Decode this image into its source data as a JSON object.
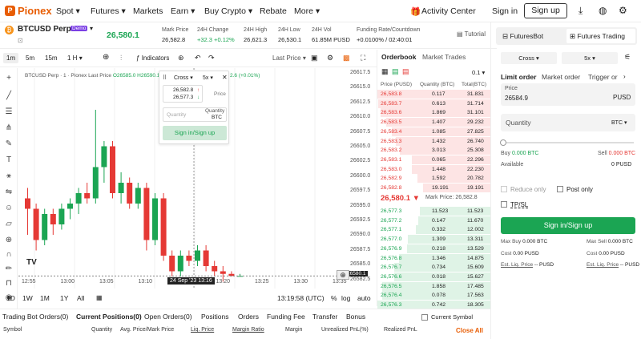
{
  "nav": {
    "logo": "Pionex",
    "logo_mark": "P",
    "items": [
      "Spot",
      "Futures",
      "Markets",
      "Earn",
      "Buy Crypto",
      "Rebate",
      "More"
    ],
    "activity": "Activity Center",
    "signin": "Sign in",
    "signup": "Sign up"
  },
  "ticker": {
    "symbol": "BTCUSD Perp",
    "badge": "Demo",
    "price": "26,580.1",
    "tutorial": "Tutorial",
    "stats": [
      {
        "label": "Mark Price",
        "value": "26,582.8",
        "color": "#222"
      },
      {
        "label": "24H Change",
        "value": "+32.3 +0.12%",
        "color": "#1ba553"
      },
      {
        "label": "24H High",
        "value": "26,621.3",
        "color": "#222"
      },
      {
        "label": "24H Low",
        "value": "26,530.1",
        "color": "#222"
      },
      {
        "label": "24H Vol",
        "value": "61.85M PUSD",
        "color": "#222"
      },
      {
        "label": "Funding Rate/Countdown",
        "value": "+0.0100% / 02:40:01",
        "color": "#222"
      }
    ]
  },
  "toolbar": {
    "intervals": [
      "1m",
      "5m",
      "15m",
      "1 H"
    ],
    "indicators": "Indicators",
    "lastprice": "Last Price"
  },
  "chart": {
    "legend": "BTCUSD Perp · 1 · Pionex Last Price",
    "legend_vals": "O26585.0 H26590.1",
    "change": "2.6 (+0.01%)",
    "price_axis": [
      "26617.5",
      "26615.0",
      "26612.5",
      "26610.0",
      "26607.5",
      "26605.0",
      "26602.5",
      "26600.0",
      "26597.5",
      "26595.0",
      "26592.5",
      "26590.0",
      "26587.5",
      "26585.0",
      "26582.5"
    ],
    "current_price_tag": "26580.1",
    "time_axis": [
      "12:55",
      "13:00",
      "13:05",
      "13:10",
      "13:15",
      "13:20",
      "13:25",
      "13:30",
      "13:35"
    ],
    "crosshair_time": "24 Sep '23  13:16",
    "utc": "13:19:58 (UTC)",
    "ranges": [
      "1D",
      "1W",
      "1M",
      "1Y",
      "All"
    ],
    "scale_opts": [
      "%",
      "log",
      "auto"
    ],
    "wm": "TV"
  },
  "chart_data": {
    "type": "candlestick",
    "x": [
      "12:54",
      "12:55",
      "12:56",
      "12:57",
      "12:58",
      "12:59",
      "13:00",
      "13:01",
      "13:02",
      "13:03",
      "13:04",
      "13:05",
      "13:06",
      "13:07",
      "13:08",
      "13:09",
      "13:10",
      "13:11",
      "13:12",
      "13:13",
      "13:14",
      "13:15",
      "13:16",
      "13:17",
      "13:18",
      "13:19"
    ],
    "candles": [
      [
        26595,
        26597,
        26588,
        26593
      ],
      [
        26593,
        26594,
        26585,
        26587
      ],
      [
        26587,
        26593,
        26586,
        26592
      ],
      [
        26592,
        26593,
        26588,
        26590
      ],
      [
        26590,
        26594,
        26589,
        26593
      ],
      [
        26593,
        26595,
        26591,
        26594
      ],
      [
        26594,
        26597,
        26592,
        26596
      ],
      [
        26596,
        26598,
        26594,
        26595
      ],
      [
        26595,
        26612,
        26594,
        26601
      ],
      [
        26601,
        26606,
        26598,
        26605
      ],
      [
        26605,
        26606,
        26595,
        26596
      ],
      [
        26596,
        26600,
        26594,
        26598
      ],
      [
        26598,
        26599,
        26593,
        26594
      ],
      [
        26594,
        26598,
        26593,
        26597
      ],
      [
        26597,
        26598,
        26585,
        26587
      ],
      [
        26587,
        26596,
        26586,
        26595
      ],
      [
        26595,
        26596,
        26583,
        26584
      ],
      [
        26584,
        26585,
        26580,
        26581
      ],
      [
        26581,
        26585,
        26580,
        26584
      ],
      [
        26584,
        26585,
        26582,
        26583
      ],
      [
        26583,
        26586,
        26582,
        26585
      ],
      [
        26585,
        26586,
        26581,
        26582
      ],
      [
        26582,
        26583,
        26580,
        26581
      ],
      [
        26581,
        26582,
        26579,
        26580.5
      ],
      [
        26580.5,
        26581,
        26580,
        26580.1
      ],
      [
        26580.1,
        26580.5,
        26580,
        26580.1
      ]
    ],
    "ylim": [
      26580,
      26620
    ]
  },
  "popup": {
    "cross": "Cross",
    "lev": "5x",
    "price1": "26,582.8",
    "price2": "26,577.3",
    "price_lbl": "Price",
    "qty_ph": "Quantity",
    "qty_lbl": "Quantity",
    "unit": "BTC",
    "btn": "Sign in/Sign up"
  },
  "book": {
    "tabs": [
      "Orderbook",
      "Market Trades"
    ],
    "step": "0.1",
    "headers": [
      "Price (PUSD)",
      "Quantity (BTC)",
      "Total(BTC)"
    ],
    "asks": [
      [
        "26,583.8",
        "0.117",
        "31.831"
      ],
      [
        "26,583.7",
        "0.613",
        "31.714"
      ],
      [
        "26,583.6",
        "1.869",
        "31.101"
      ],
      [
        "26,583.5",
        "1.407",
        "29.232"
      ],
      [
        "26,583.4",
        "1.085",
        "27.825"
      ],
      [
        "26,583.3",
        "1.432",
        "26.740"
      ],
      [
        "26,583.2",
        "3.013",
        "25.308"
      ],
      [
        "26,583.1",
        "0.065",
        "22.296"
      ],
      [
        "26,583.0",
        "1.448",
        "22.230"
      ],
      [
        "26,582.9",
        "1.592",
        "20.782"
      ],
      [
        "26,582.8",
        "19.191",
        "19.191"
      ]
    ],
    "ask_depth": [
      1.0,
      0.99,
      0.97,
      0.92,
      0.87,
      0.84,
      0.8,
      0.7,
      0.7,
      0.65,
      0.6
    ],
    "last": "26,580.1 ▼",
    "mark": "Mark Price: 26,582.8",
    "bids": [
      [
        "26,577.3",
        "11.523",
        "11.523"
      ],
      [
        "26,577.2",
        "0.147",
        "11.670"
      ],
      [
        "26,577.1",
        "0.332",
        "12.002"
      ],
      [
        "26,577.0",
        "1.309",
        "13.311"
      ],
      [
        "26,576.9",
        "0.218",
        "13.529"
      ],
      [
        "26,576.8",
        "1.346",
        "14.875"
      ],
      [
        "26,576.7",
        "0.734",
        "15.609"
      ],
      [
        "26,576.6",
        "0.018",
        "15.627"
      ],
      [
        "26,576.5",
        "1.858",
        "17.485"
      ],
      [
        "26,576.4",
        "0.078",
        "17.563"
      ],
      [
        "26,576.3",
        "0.742",
        "18.305"
      ]
    ],
    "bid_depth": [
      0.63,
      0.64,
      0.66,
      0.73,
      0.74,
      0.81,
      0.85,
      0.85,
      0.96,
      0.96,
      1.0
    ]
  },
  "panel": {
    "tabs": [
      "FuturesBot",
      "Futures Trading"
    ],
    "margin": "Cross",
    "lev": "5x",
    "types": [
      "Limit order",
      "Market order",
      "Trigger or"
    ],
    "price_lbl": "Price",
    "price_val": "26584.9",
    "price_unit": "PUSD",
    "qty_lbl": "Quantity",
    "qty_unit": "BTC",
    "buy": "Buy",
    "buy_val": "0.000 BTC",
    "sell": "Sell",
    "sell_val": "0.000 BTC",
    "available": "Available",
    "avail_val": "0 PUSD",
    "reduce": "Reduce only",
    "post": "Post only",
    "tpsl": "TP/SL",
    "btn": "Sign in/Sign up",
    "maxbuy_l": "Max Buy",
    "maxbuy": "0.000 BTC",
    "maxsell_l": "Max Sell",
    "maxsell": "0.000 BTC",
    "cost_l": "Cost",
    "cost_buy": "0.00 PUSD",
    "cost_sell": "0.00 PUSD",
    "liq_l": "Est. Liq. Price",
    "liq": "-- PUSD"
  },
  "bottom": {
    "tabs": [
      "Trading Bot Orders(0)",
      "Current Positions(0)",
      "Open Orders(0)",
      "Positions",
      "Orders",
      "Funding Fee",
      "Transfer",
      "Bonus"
    ],
    "current_symbol": "Current Symbol",
    "cols": [
      "Symbol",
      "Quantity",
      "Avg. Price/Mark Price",
      "Liq. Price",
      "Margin Ratio",
      "Margin",
      "Unrealized PnL(%)",
      "Realized PnL"
    ],
    "close_all": "Close All"
  }
}
